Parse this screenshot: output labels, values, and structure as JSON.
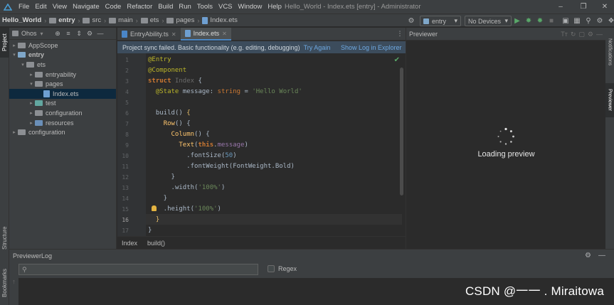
{
  "menubar": {
    "items": [
      "File",
      "Edit",
      "View",
      "Navigate",
      "Code",
      "Refactor",
      "Build",
      "Run",
      "Tools",
      "VCS",
      "Window",
      "Help"
    ],
    "window_title": "Hello_World - Index.ets [entry] - Administrator"
  },
  "navbar": {
    "crumbs": [
      "Hello_World",
      "entry",
      "src",
      "main",
      "ets",
      "pages",
      "Index.ets"
    ],
    "run_config": "entry",
    "device": "No Devices"
  },
  "left_strip": {
    "tabs": [
      "Project",
      "Structure",
      "Bookmarks"
    ]
  },
  "project": {
    "view_name": "Ohos",
    "tree": [
      {
        "label": "AppScope",
        "depth": 0,
        "expanded": false,
        "icon": "folder"
      },
      {
        "label": "entry",
        "depth": 0,
        "expanded": true,
        "icon": "module-folder"
      },
      {
        "label": "ets",
        "depth": 1,
        "expanded": true,
        "icon": "folder"
      },
      {
        "label": "entryability",
        "depth": 2,
        "expanded": false,
        "icon": "folder"
      },
      {
        "label": "pages",
        "depth": 2,
        "expanded": true,
        "icon": "folder"
      },
      {
        "label": "Index.ets",
        "depth": 3,
        "expanded": null,
        "icon": "ets-file",
        "selected": true
      },
      {
        "label": "test",
        "depth": 2,
        "expanded": false,
        "icon": "test-folder"
      },
      {
        "label": "configuration",
        "depth": 1,
        "expanded": false,
        "icon": "folder"
      },
      {
        "label": "resources",
        "depth": 1,
        "expanded": false,
        "icon": "resources-folder"
      },
      {
        "label": "configuration",
        "depth": 0,
        "expanded": false,
        "icon": "folder"
      }
    ]
  },
  "editor": {
    "tabs": [
      {
        "label": "EntryAbility.ts",
        "active": false
      },
      {
        "label": "Index.ets",
        "active": true
      }
    ],
    "notification": {
      "message": "Project sync failed. Basic functionality (e.g. editing, debugging)",
      "action": "Try Again",
      "action2": "Show Log in Explorer"
    },
    "line_numbers": [
      "1",
      "2",
      "3",
      "4",
      "5",
      "6",
      "7",
      "8",
      "9",
      "10",
      "11",
      "12",
      "13",
      "14",
      "15",
      "16",
      "17"
    ],
    "current_line": 16,
    "code": {
      "l1": "@Entry",
      "l2": "@Component",
      "l3_kw": "struct",
      "l3_name": "Index",
      "l4_deco": "@State",
      "l4_var": "message",
      "l4_type": "string",
      "l4_str": "'Hello World'",
      "l6": "build",
      "l7": "Row",
      "l8": "Column",
      "l9_fn": "Text",
      "l9_this": "this",
      "l9_prop": "message",
      "l10_fn": "fontSize",
      "l10_num": "50",
      "l11_fn": "fontWeight",
      "l11_arg": "FontWeight.Bold",
      "l13_fn": "width",
      "l13_str": "'100%'",
      "l15_fn": "height",
      "l15_str": "'100%'"
    },
    "breadcrumb": [
      "Index",
      "build()"
    ]
  },
  "previewer": {
    "title": "Previewer",
    "loading_text": "Loading preview"
  },
  "right_strip": {
    "tabs": [
      "Notifications",
      "Previewer"
    ]
  },
  "bottom_panel": {
    "title": "PreviewerLog",
    "search_placeholder": "",
    "regex_label": "Regex",
    "regex_checked": false
  },
  "watermark": "CSDN @一一 . Miraitowa",
  "colors": {
    "keyword": "#cc7832",
    "decorator": "#bbb529",
    "string": "#6a8759",
    "number": "#6897bb",
    "accent": "#4a88c7",
    "run_green": "#59a869"
  }
}
